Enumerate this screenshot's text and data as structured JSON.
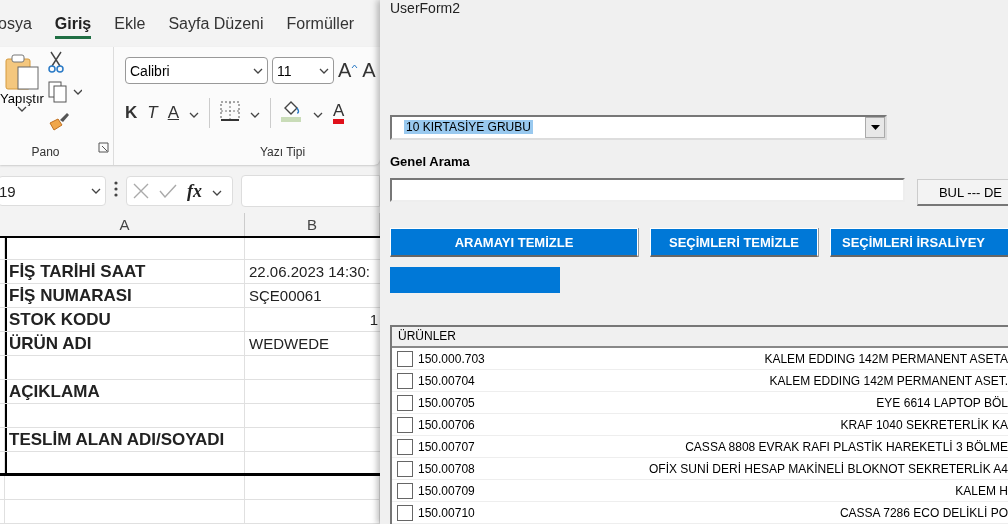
{
  "excel": {
    "tabs": [
      {
        "label": "osya",
        "selected": false
      },
      {
        "label": "Giriş",
        "selected": true
      },
      {
        "label": "Ekle",
        "selected": false
      },
      {
        "label": "Sayfa Düzeni",
        "selected": false
      },
      {
        "label": "Formüller",
        "selected": false
      }
    ],
    "clipboard": {
      "paste_label": "Yapıştır",
      "title": "Pano"
    },
    "font": {
      "name": "Calibri",
      "size": "11",
      "grow_letter": "A",
      "shrink_letter": "A",
      "bold_letter": "K",
      "italic_letter": "T",
      "underline_letter": "A",
      "color_letter": "A",
      "title": "Yazı Tipi"
    },
    "name_box": "19",
    "fx": "fx",
    "columns": [
      "A",
      "B"
    ],
    "rows": [
      {
        "kind": "blank"
      },
      {
        "kind": "field",
        "label": "FİŞ TARİHİ SAAT",
        "value": "22.06.2023 14:30:"
      },
      {
        "kind": "field",
        "label": "FİŞ NUMARASI",
        "value": "SÇE00061"
      },
      {
        "kind": "numeric",
        "label": "STOK KODU",
        "value": "1"
      },
      {
        "kind": "field",
        "label": "ÜRÜN ADI",
        "value": "WEDWEDE"
      },
      {
        "kind": "blank"
      },
      {
        "kind": "field",
        "label": "AÇIKLAMA"
      },
      {
        "kind": "blank"
      },
      {
        "kind": "field",
        "label": "TESLİM ALAN ADI/SOYADI"
      },
      {
        "kind": "blank"
      },
      {
        "kind": "outside"
      },
      {
        "kind": "outside"
      }
    ]
  },
  "userform": {
    "title": "UserForm2",
    "group_combo": {
      "value": "10  KIRTASİYE GRUBU"
    },
    "search_label": "Genel Arama",
    "search_button": "BUL  --- DE",
    "buttons": [
      "ARAMAYI TEMİZLE",
      "SEÇİMLERİ TEMİZLE",
      "SEÇİMLERİ İRSALİYEY"
    ],
    "list": {
      "header": "ÜRÜNLER",
      "items": [
        {
          "code": "150.000.703",
          "name": "KALEM EDDING 142M PERMANENT ASETA",
          "checked": false
        },
        {
          "code": "150.00704",
          "name": "KALEM EDDING 142M PERMANENT ASET.",
          "checked": false
        },
        {
          "code": "150.00705",
          "name": "EYE 6614 LAPTOP BÖL",
          "checked": false
        },
        {
          "code": "150.00706",
          "name": "KRAF 1040 SEKRETERLİK KA",
          "checked": false
        },
        {
          "code": "150.00707",
          "name": "CASSA 8808 EVRAK RAFI PLASTİK HAREKETLİ 3 BÖLME",
          "checked": false
        },
        {
          "code": "150.00708",
          "name": "OFİX SUNİ DERİ HESAP MAKİNELİ BLOKNOT SEKRETERLİK A4",
          "checked": false
        },
        {
          "code": "150.00709",
          "name": "KALEM H",
          "checked": false
        },
        {
          "code": "150.00710",
          "name": "CASSA 7286 ECO DELİKLİ PO",
          "checked": false
        }
      ]
    }
  }
}
